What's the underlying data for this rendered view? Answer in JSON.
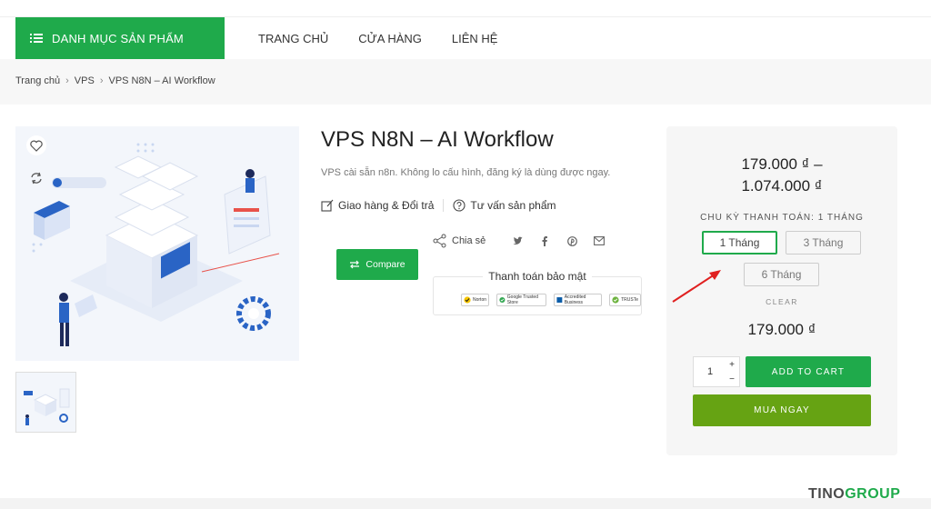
{
  "header": {
    "category_label": "DANH MỤC SẢN PHẨM",
    "nav": [
      "TRANG CHỦ",
      "CỬA HÀNG",
      "LIÊN HỆ"
    ]
  },
  "breadcrumb": {
    "items": [
      "Trang chủ",
      "VPS",
      "VPS N8N – AI Workflow"
    ],
    "separator": "›"
  },
  "product": {
    "title": "VPS N8N – AI Workflow",
    "description": "VPS cài sẵn n8n. Không lo cấu hình, đăng ký là dùng được ngay.",
    "shipping_label": "Giao hàng & Đổi trả",
    "consult_label": "Tư vấn sản phẩm",
    "compare_label": "Compare",
    "share_label": "Chia sẻ",
    "social_icons": [
      "twitter-icon",
      "facebook-icon",
      "pinterest-icon",
      "email-icon"
    ],
    "payment_title": "Thanh toán bảo mật",
    "payment_logos": [
      "Norton",
      "Google Trusted Store",
      "Accredited Business",
      "TRUSTe"
    ]
  },
  "purchase": {
    "price_range_low": "179.000 ₫ –",
    "price_range_high": "1.074.000 ₫",
    "cycle_label": "CHU KỲ THANH TOÁN: 1 THÁNG",
    "options": [
      "1 Tháng",
      "3 Tháng",
      "6 Tháng"
    ],
    "selected_option": "1 Tháng",
    "clear_label": "CLEAR",
    "price": "179.000 ₫",
    "quantity": "1",
    "plus": "+",
    "minus": "−",
    "add_to_cart": "ADD TO CART",
    "buy_now": "MUA NGAY"
  },
  "brand": {
    "part1": "TINO",
    "part2": "GROUP"
  },
  "colors": {
    "primary_green": "#1faa4b",
    "buy_green": "#66a313",
    "arrow_red": "#e02020"
  }
}
